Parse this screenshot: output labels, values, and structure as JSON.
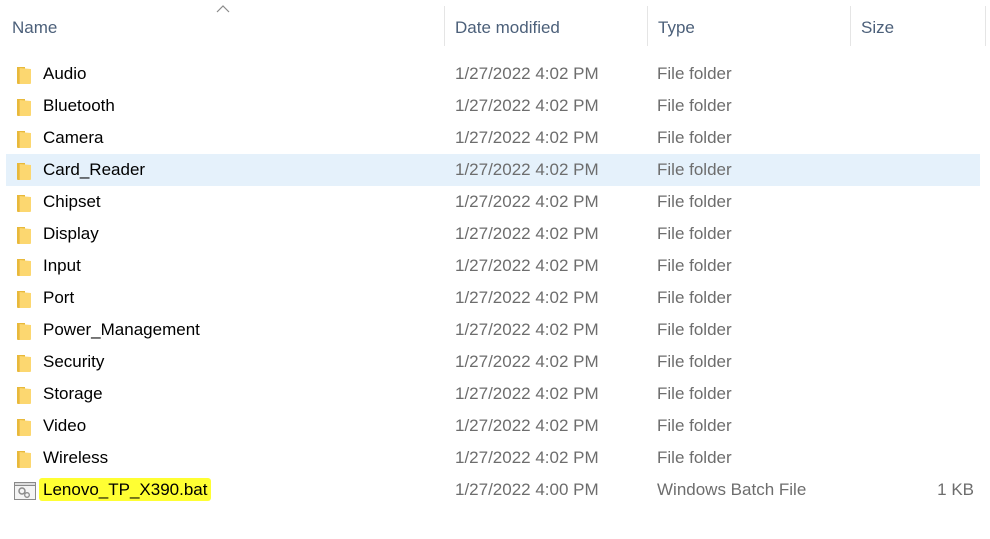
{
  "columns": {
    "name": "Name",
    "date": "Date modified",
    "type": "Type",
    "size": "Size",
    "sorted_by": "name",
    "sort_direction": "ascending"
  },
  "highlight_color": "#ffff33",
  "selection_color": "#e5f1fb",
  "files": [
    {
      "name": "Audio",
      "date": "1/27/2022 4:02 PM",
      "type": "File folder",
      "size": "",
      "icon": "folder-icon"
    },
    {
      "name": "Bluetooth",
      "date": "1/27/2022 4:02 PM",
      "type": "File folder",
      "size": "",
      "icon": "folder-icon"
    },
    {
      "name": "Camera",
      "date": "1/27/2022 4:02 PM",
      "type": "File folder",
      "size": "",
      "icon": "folder-icon"
    },
    {
      "name": "Card_Reader",
      "date": "1/27/2022 4:02 PM",
      "type": "File folder",
      "size": "",
      "icon": "folder-icon",
      "state": "hover"
    },
    {
      "name": "Chipset",
      "date": "1/27/2022 4:02 PM",
      "type": "File folder",
      "size": "",
      "icon": "folder-icon"
    },
    {
      "name": "Display",
      "date": "1/27/2022 4:02 PM",
      "type": "File folder",
      "size": "",
      "icon": "folder-icon"
    },
    {
      "name": "Input",
      "date": "1/27/2022 4:02 PM",
      "type": "File folder",
      "size": "",
      "icon": "folder-icon"
    },
    {
      "name": "Port",
      "date": "1/27/2022 4:02 PM",
      "type": "File folder",
      "size": "",
      "icon": "folder-icon"
    },
    {
      "name": "Power_Management",
      "date": "1/27/2022 4:02 PM",
      "type": "File folder",
      "size": "",
      "icon": "folder-icon"
    },
    {
      "name": "Security",
      "date": "1/27/2022 4:02 PM",
      "type": "File folder",
      "size": "",
      "icon": "folder-icon"
    },
    {
      "name": "Storage",
      "date": "1/27/2022 4:02 PM",
      "type": "File folder",
      "size": "",
      "icon": "folder-icon"
    },
    {
      "name": "Video",
      "date": "1/27/2022 4:02 PM",
      "type": "File folder",
      "size": "",
      "icon": "folder-icon"
    },
    {
      "name": "Wireless",
      "date": "1/27/2022 4:02 PM",
      "type": "File folder",
      "size": "",
      "icon": "folder-icon"
    },
    {
      "name": "Lenovo_TP_X390.bat",
      "date": "1/27/2022 4:00 PM",
      "type": "Windows Batch File",
      "size": "1 KB",
      "icon": "batch-file-icon",
      "highlighted": true
    }
  ]
}
